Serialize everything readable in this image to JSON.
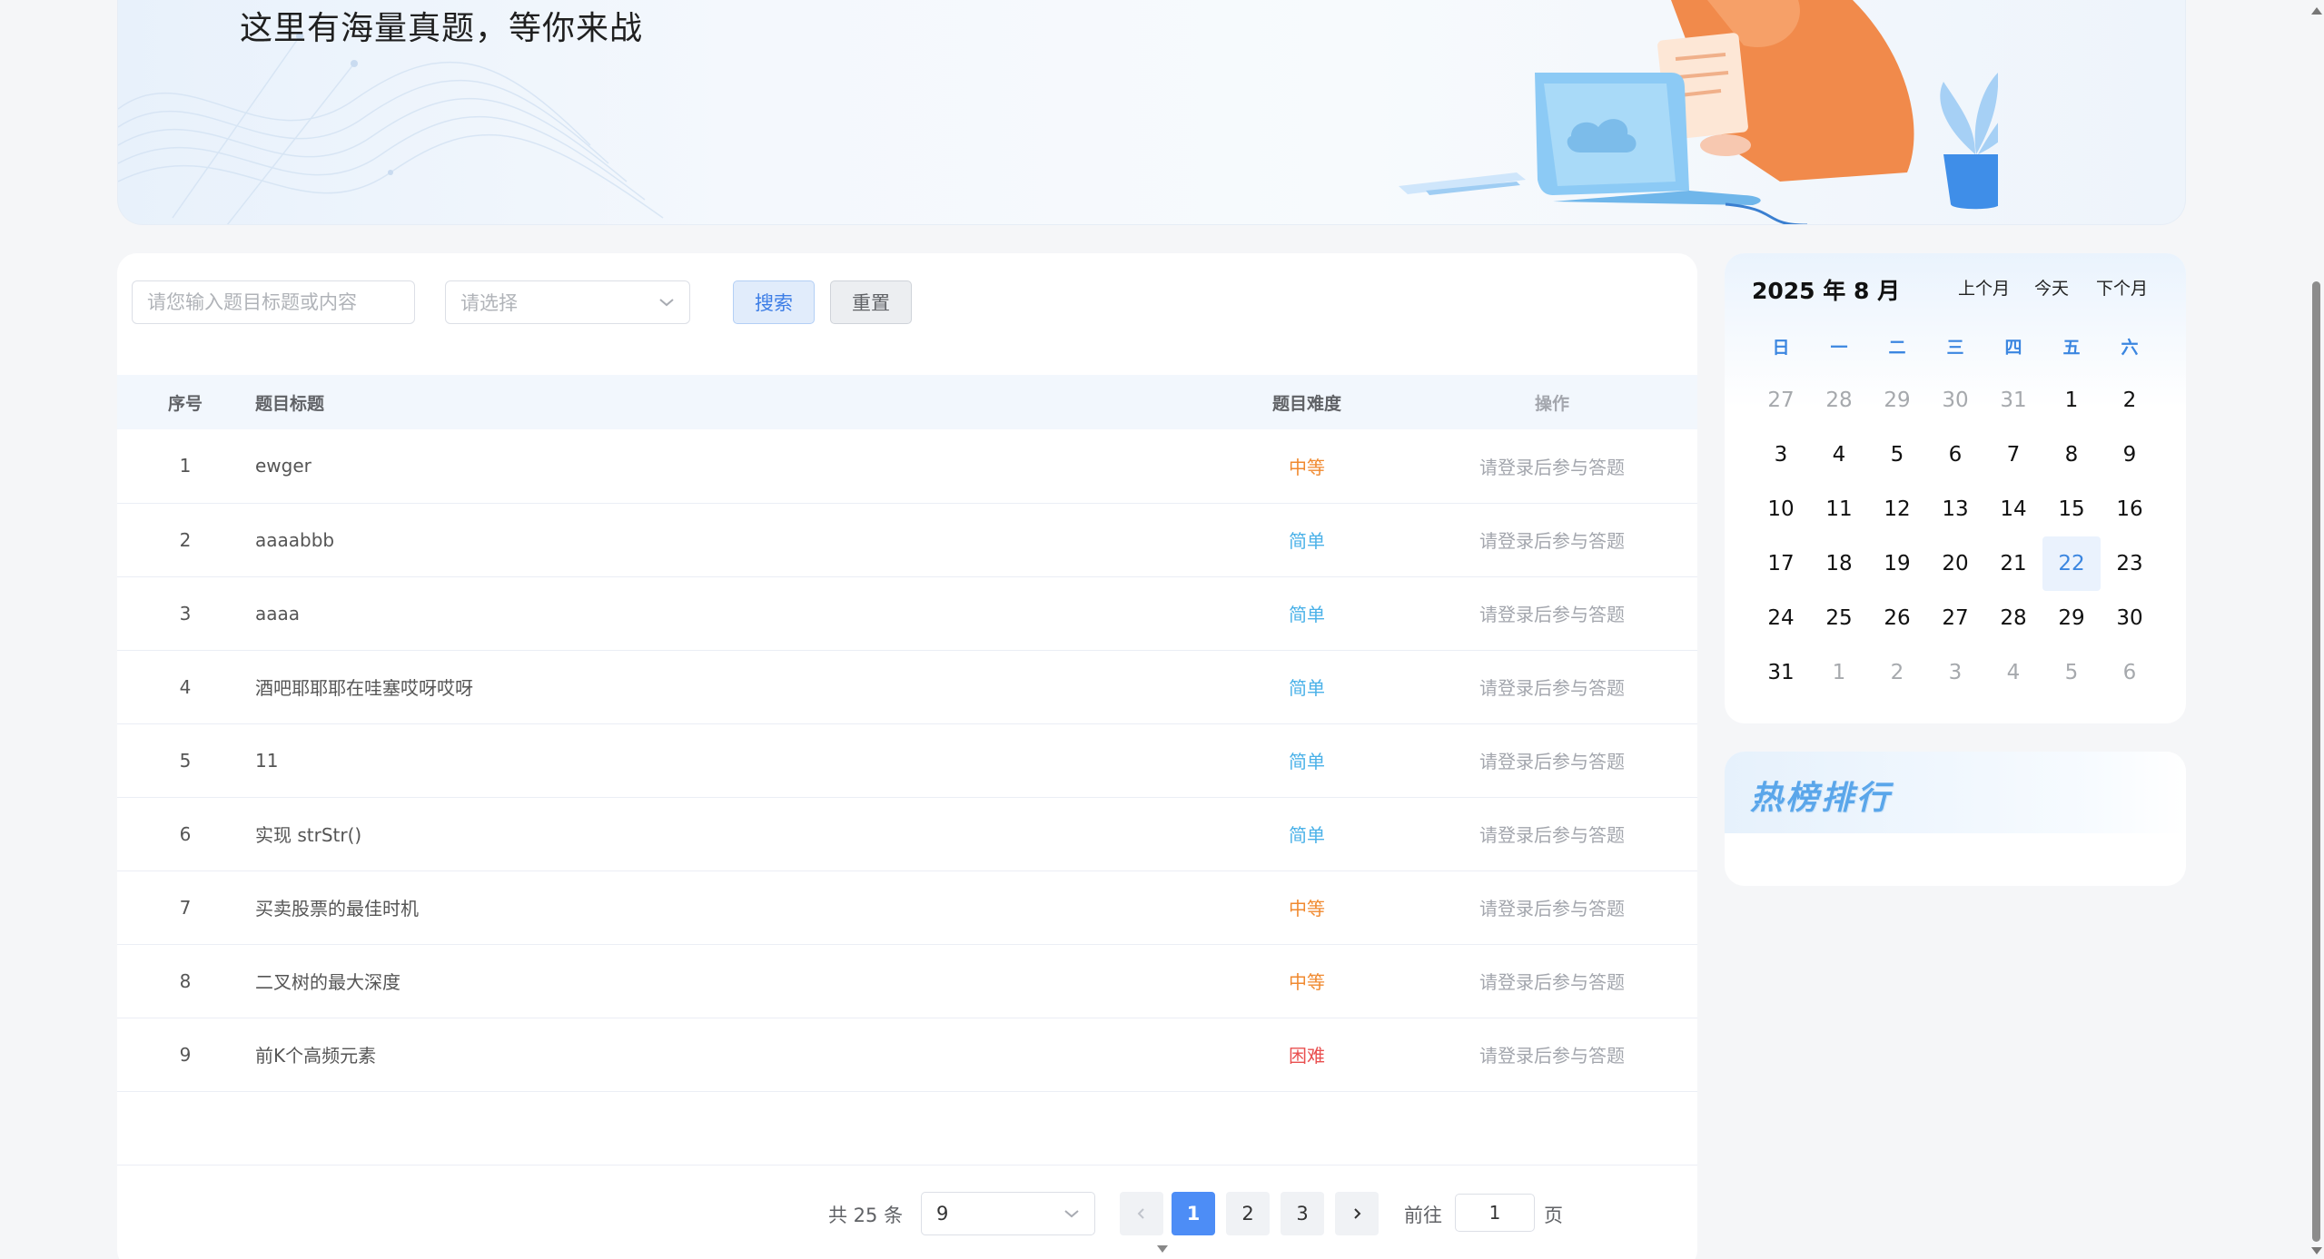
{
  "banner": {
    "title": "这里有海量真题，等你来战"
  },
  "filters": {
    "search_placeholder": "请您输入题目标题或内容",
    "select_placeholder": "请选择",
    "search_label": "搜索",
    "reset_label": "重置"
  },
  "table": {
    "headers": {
      "no": "序号",
      "title": "题目标题",
      "difficulty": "题目难度",
      "action": "操作"
    },
    "rows": [
      {
        "no": "1",
        "title": "ewger",
        "difficulty": "中等",
        "level": "medium",
        "action": "请登录后参与答题"
      },
      {
        "no": "2",
        "title": "aaaabbb",
        "difficulty": "简单",
        "level": "easy",
        "action": "请登录后参与答题"
      },
      {
        "no": "3",
        "title": "aaaa",
        "difficulty": "简单",
        "level": "easy",
        "action": "请登录后参与答题"
      },
      {
        "no": "4",
        "title": "酒吧耶耶耶在哇塞哎呀哎呀",
        "difficulty": "简单",
        "level": "easy",
        "action": "请登录后参与答题"
      },
      {
        "no": "5",
        "title": "11",
        "difficulty": "简单",
        "level": "easy",
        "action": "请登录后参与答题"
      },
      {
        "no": "6",
        "title": "实现 strStr()",
        "difficulty": "简单",
        "level": "easy",
        "action": "请登录后参与答题"
      },
      {
        "no": "7",
        "title": "买卖股票的最佳时机",
        "difficulty": "中等",
        "level": "medium",
        "action": "请登录后参与答题"
      },
      {
        "no": "8",
        "title": "二叉树的最大深度",
        "difficulty": "中等",
        "level": "medium",
        "action": "请登录后参与答题"
      },
      {
        "no": "9",
        "title": "前K个高频元素",
        "difficulty": "困难",
        "level": "hard",
        "action": "请登录后参与答题"
      }
    ]
  },
  "pagination": {
    "total_text": "共 25 条",
    "page_size": "9",
    "pages": [
      "1",
      "2",
      "3"
    ],
    "current_page": "1",
    "goto_label": "前往",
    "goto_value": "1",
    "page_unit": "页"
  },
  "calendar": {
    "title": "2025 年 8 月",
    "prev_label": "上个月",
    "today_label": "今天",
    "next_label": "下个月",
    "weekdays": [
      "日",
      "一",
      "二",
      "三",
      "四",
      "五",
      "六"
    ],
    "weeks": [
      [
        {
          "d": "27",
          "m": true
        },
        {
          "d": "28",
          "m": true
        },
        {
          "d": "29",
          "m": true
        },
        {
          "d": "30",
          "m": true
        },
        {
          "d": "31",
          "m": true
        },
        {
          "d": "1"
        },
        {
          "d": "2"
        }
      ],
      [
        {
          "d": "3"
        },
        {
          "d": "4"
        },
        {
          "d": "5"
        },
        {
          "d": "6"
        },
        {
          "d": "7"
        },
        {
          "d": "8"
        },
        {
          "d": "9"
        }
      ],
      [
        {
          "d": "10"
        },
        {
          "d": "11"
        },
        {
          "d": "12"
        },
        {
          "d": "13"
        },
        {
          "d": "14"
        },
        {
          "d": "15"
        },
        {
          "d": "16"
        }
      ],
      [
        {
          "d": "17"
        },
        {
          "d": "18"
        },
        {
          "d": "19"
        },
        {
          "d": "20"
        },
        {
          "d": "21"
        },
        {
          "d": "22",
          "today": true
        },
        {
          "d": "23"
        }
      ],
      [
        {
          "d": "24"
        },
        {
          "d": "25"
        },
        {
          "d": "26"
        },
        {
          "d": "27"
        },
        {
          "d": "28"
        },
        {
          "d": "29"
        },
        {
          "d": "30"
        }
      ],
      [
        {
          "d": "31"
        },
        {
          "d": "1",
          "m": true
        },
        {
          "d": "2",
          "m": true
        },
        {
          "d": "3",
          "m": true
        },
        {
          "d": "4",
          "m": true
        },
        {
          "d": "5",
          "m": true
        },
        {
          "d": "6",
          "m": true
        }
      ]
    ]
  },
  "hot": {
    "title": "热榜排行"
  },
  "colors": {
    "primary": "#4d8df6",
    "medium": "#f0892f",
    "easy": "#4ab1e8",
    "hard": "#e94f4f"
  }
}
